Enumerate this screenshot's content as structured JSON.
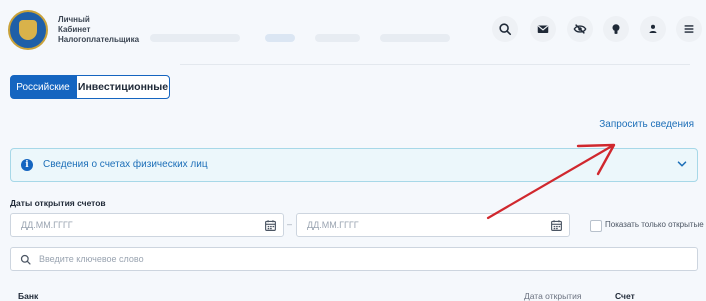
{
  "header": {
    "logo_lines": [
      "Личный",
      "Кабинет",
      "Налогоплательщика"
    ],
    "icons": [
      "search-icon",
      "mail-icon",
      "eye-off-icon",
      "lightbulb-icon",
      "user-icon",
      "menu-icon"
    ]
  },
  "tabs": [
    {
      "label": "Российские",
      "active": true
    },
    {
      "label": "Инвестиционные",
      "active": false
    }
  ],
  "request_link": "Запросить сведения",
  "accordion": {
    "title": "Сведения о счетах физических лиц",
    "icon": "info-icon"
  },
  "dates": {
    "section_label": "Даты открытия счетов",
    "from_placeholder": "ДД.ММ.ГГГГ",
    "to_placeholder": "ДД.ММ.ГГГГ",
    "separator": "–"
  },
  "filter": {
    "only_open_label": "Показать только открытые"
  },
  "search": {
    "placeholder": "Введите ключевое слово"
  },
  "table": {
    "headers": [
      "Банк",
      "Дата открытия",
      "Счет"
    ]
  },
  "colors": {
    "accent": "#1565c0",
    "link": "#1d6fb8",
    "arrow": "#d0282e"
  }
}
